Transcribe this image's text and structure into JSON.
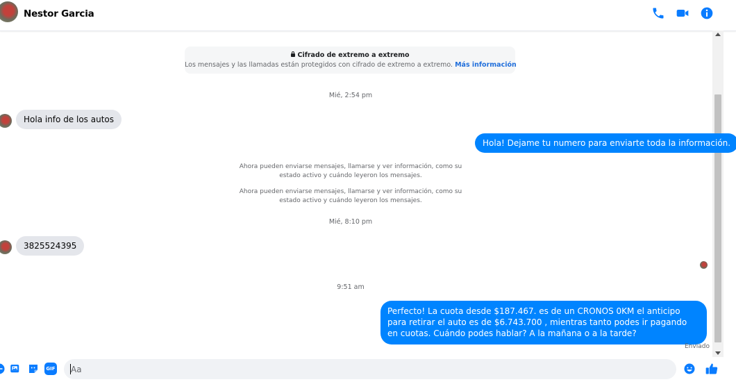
{
  "header": {
    "contact_name": "Nestor Garcia",
    "icons": [
      "phone-icon",
      "video-camera-icon",
      "info-icon"
    ]
  },
  "encryption": {
    "title": "Cifrado de extremo a extremo",
    "body": "Los mensajes y las llamadas están protegidos con cifrado de extremo a extremo.",
    "link": "Más información"
  },
  "timestamps": {
    "t1": "Mié, 2:54 pm",
    "t2": "Mié, 8:10 pm",
    "t3": "9:51 am"
  },
  "messages": {
    "m1": "Hola info de los autos",
    "m2": "Hola! Dejame tu numero  para enviarte toda la información.",
    "m3": "3825524395",
    "m4": "Perfecto! La cuota desde $187.467. es de un CRONOS 0KM el anticipo para retirar el auto es de $6.743.700 , mientras tanto podes ir pagando en cuotas. Cuándo podes hablar? A la mañana o a la tarde?"
  },
  "notices": {
    "n1": "Ahora pueden enviarse mensajes, llamarse y ver información, como su estado activo y cuándo leyeron los mensajes.",
    "n2": "Ahora pueden enviarse mensajes, llamarse y ver información, como su estado activo y cuándo leyeron los mensajes."
  },
  "status_label": "Enviado",
  "composer": {
    "placeholder": "Aa",
    "tools": [
      "photo-icon",
      "sticker-icon",
      "gif-icon"
    ],
    "gif_label": "GIF"
  },
  "colors": {
    "accent": "#0084ff",
    "incoming_bubble": "#e4e6eb",
    "muted_text": "#65676b"
  }
}
